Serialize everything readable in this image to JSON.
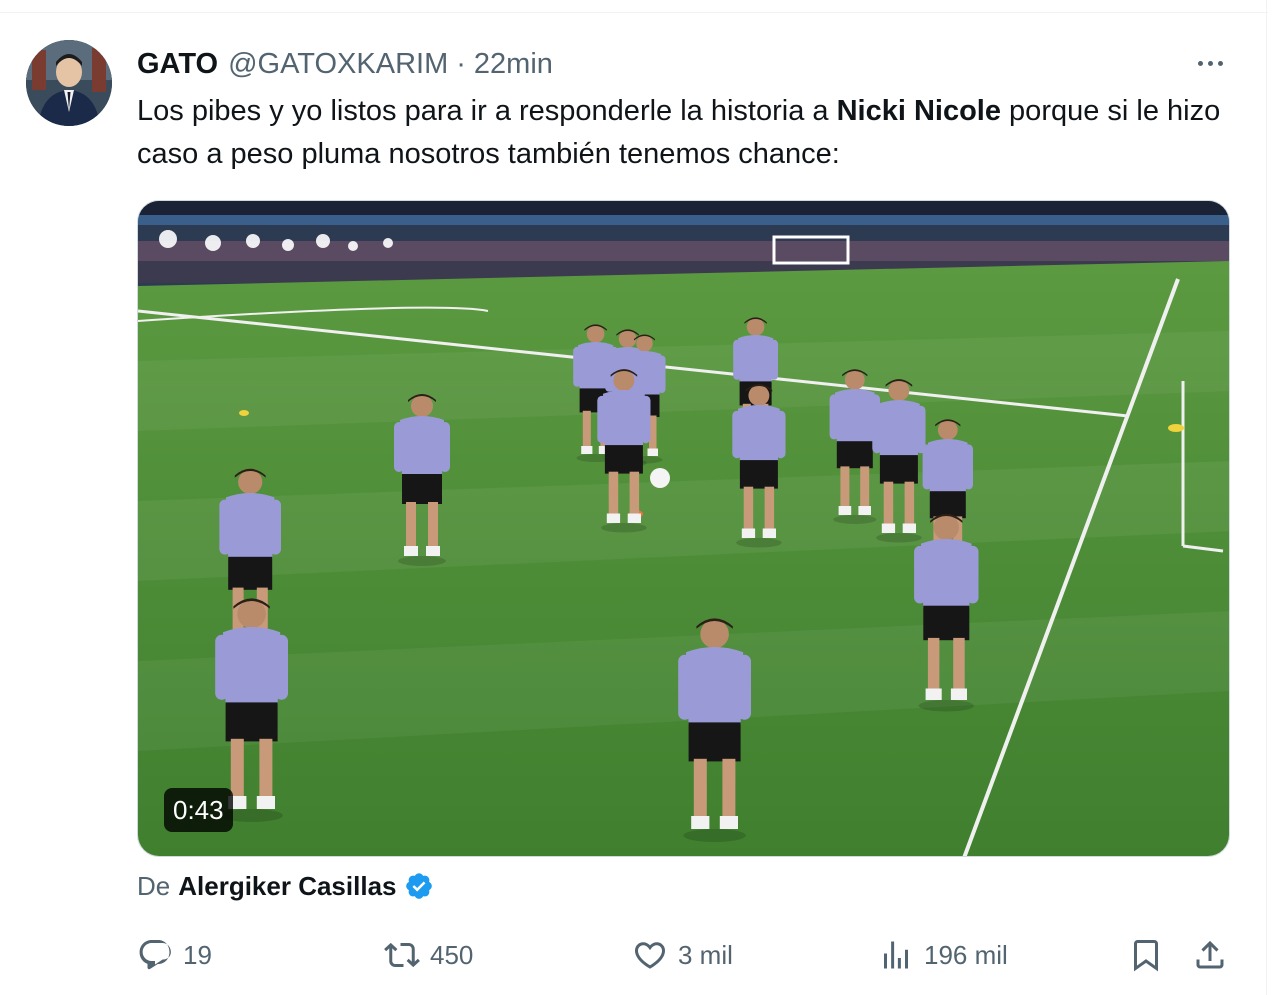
{
  "tweet": {
    "author_name": "GATO",
    "handle": "@GATOXKARIM",
    "separator": "·",
    "time": "22min",
    "text_before": "Los pibes y yo listos para ir a responderle la historia a ",
    "text_bold": "Nicki Nicole",
    "text_after": " porque si le hizo caso a peso pluma nosotros también tenemos chance:"
  },
  "media": {
    "type": "video",
    "duration": "0:43"
  },
  "source": {
    "prefix": "De",
    "name": "Alergiker Casillas",
    "verified": true
  },
  "actions": {
    "replies": "19",
    "retweets": "450",
    "likes": "3 mil",
    "views": "196 mil"
  },
  "icons": {
    "more": "more-icon",
    "reply": "reply-icon",
    "retweet": "retweet-icon",
    "like": "like-icon",
    "views": "views-icon",
    "bookmark": "bookmark-icon",
    "share": "share-icon",
    "verified": "verified-badge-icon"
  },
  "colors": {
    "text_primary": "#0f1419",
    "text_secondary": "#536471",
    "verified_blue": "#1d9bf0",
    "pitch_green": "#4a8a35"
  }
}
